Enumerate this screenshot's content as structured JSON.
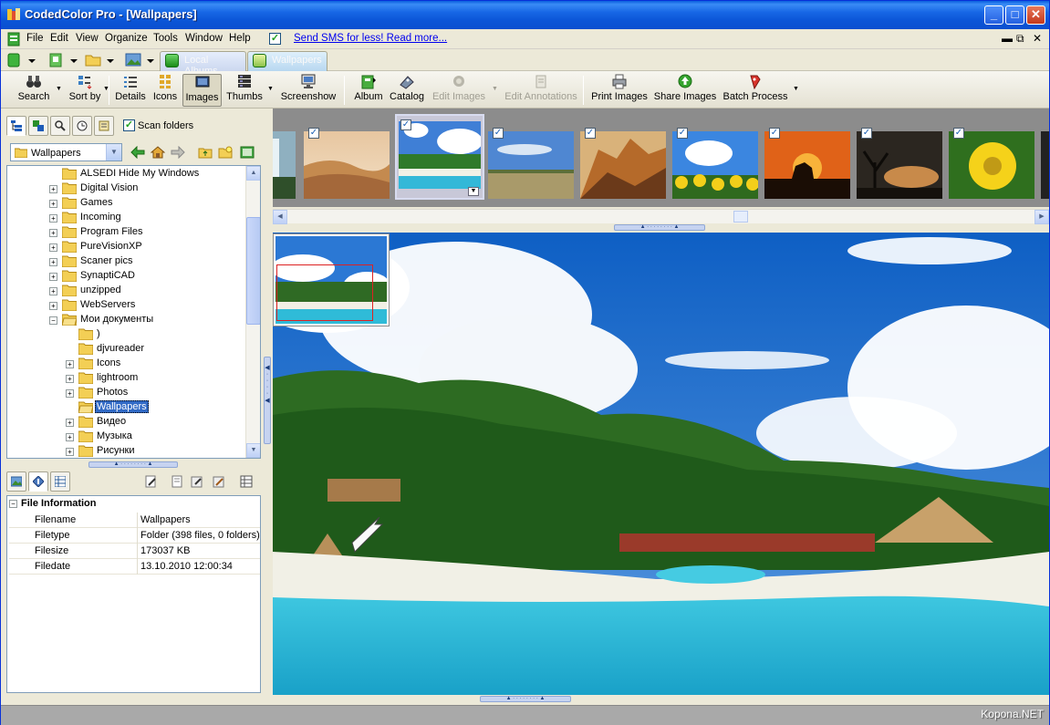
{
  "window": {
    "title": "CodedColor Pro - [Wallpapers]"
  },
  "menu": {
    "items": [
      "File",
      "Edit",
      "View",
      "Organize",
      "Tools",
      "Window",
      "Help"
    ],
    "sms_link": "Send SMS for less! Read more..."
  },
  "tabs": [
    "Local Albums",
    "Wallpapers"
  ],
  "toolbar": {
    "buttons": [
      {
        "label": "Search",
        "icon": "binoculars-icon",
        "enabled": true
      },
      {
        "label": "Sort by",
        "icon": "sort-icon",
        "enabled": true
      },
      {
        "label": "Details",
        "icon": "details-icon",
        "enabled": true
      },
      {
        "label": "Icons",
        "icon": "icons-grid-icon",
        "enabled": true
      },
      {
        "label": "Images",
        "icon": "images-icon",
        "enabled": true,
        "pressed": true
      },
      {
        "label": "Thumbs",
        "icon": "thumbs-icon",
        "enabled": true
      },
      {
        "label": "Screenshow",
        "icon": "monitor-icon",
        "enabled": true
      },
      {
        "label": "Album",
        "icon": "album-icon",
        "enabled": true
      },
      {
        "label": "Catalog",
        "icon": "catalog-icon",
        "enabled": true
      },
      {
        "label": "Edit Images",
        "icon": "edit-images-icon",
        "enabled": false
      },
      {
        "label": "Edit Annotations",
        "icon": "annotations-icon",
        "enabled": false
      },
      {
        "label": "Print Images",
        "icon": "printer-icon",
        "enabled": true
      },
      {
        "label": "Share Images",
        "icon": "share-icon",
        "enabled": true
      },
      {
        "label": "Batch Process",
        "icon": "batch-icon",
        "enabled": true
      }
    ]
  },
  "left_panel": {
    "scan_folders_label": "Scan folders",
    "scan_folders_checked": true,
    "path_value": "Wallpapers",
    "tree": [
      {
        "label": "ALSEDI Hide My Windows",
        "level": 0,
        "expandable": false
      },
      {
        "label": "Digital Vision",
        "level": 0,
        "expandable": true
      },
      {
        "label": "Games",
        "level": 0,
        "expandable": true
      },
      {
        "label": "Incoming",
        "level": 0,
        "expandable": true
      },
      {
        "label": "Program Files",
        "level": 0,
        "expandable": true
      },
      {
        "label": "PureVisionXP",
        "level": 0,
        "expandable": true
      },
      {
        "label": "Scaner pics",
        "level": 0,
        "expandable": true
      },
      {
        "label": "SynaptiCAD",
        "level": 0,
        "expandable": true
      },
      {
        "label": "unzipped",
        "level": 0,
        "expandable": true
      },
      {
        "label": "WebServers",
        "level": 0,
        "expandable": true
      },
      {
        "label": "Мои документы",
        "level": 0,
        "expandable": true,
        "expanded": true
      },
      {
        "label": ")",
        "level": 1,
        "expandable": false
      },
      {
        "label": "djvureader",
        "level": 1,
        "expandable": false
      },
      {
        "label": "Icons",
        "level": 1,
        "expandable": true
      },
      {
        "label": "lightroom",
        "level": 1,
        "expandable": true
      },
      {
        "label": "Photos",
        "level": 1,
        "expandable": true
      },
      {
        "label": "Wallpapers",
        "level": 1,
        "expandable": false,
        "selected": true
      },
      {
        "label": "Видео",
        "level": 1,
        "expandable": true
      },
      {
        "label": "Музыка",
        "level": 1,
        "expandable": true
      },
      {
        "label": "Рисунки",
        "level": 1,
        "expandable": true
      }
    ]
  },
  "file_info": {
    "header": "File Information",
    "rows": [
      {
        "key": "Filename",
        "value": "Wallpapers"
      },
      {
        "key": "Filetype",
        "value": "Folder (398 files, 0 folders)"
      },
      {
        "key": "Filesize",
        "value": "173037 KB"
      },
      {
        "key": "Filedate",
        "value": "13.10.2010 12:00:34"
      }
    ]
  },
  "thumbnails": [
    {
      "name": "waterfall",
      "checked": false,
      "selected": false
    },
    {
      "name": "desert",
      "checked": true,
      "selected": false
    },
    {
      "name": "tropical-beach",
      "checked": true,
      "selected": true
    },
    {
      "name": "meadow",
      "checked": true,
      "selected": false
    },
    {
      "name": "canyon",
      "checked": true,
      "selected": false
    },
    {
      "name": "sunflowers",
      "checked": true,
      "selected": false
    },
    {
      "name": "horse-sunset",
      "checked": true,
      "selected": false
    },
    {
      "name": "tree-dusk",
      "checked": true,
      "selected": false
    },
    {
      "name": "yellow-flower",
      "checked": true,
      "selected": false
    }
  ],
  "watermark": "Kopona.NET",
  "colors": {
    "titlebar": "#0a5fde",
    "selection": "#316ac5",
    "link": "#0000ee",
    "check": "#21a121"
  }
}
